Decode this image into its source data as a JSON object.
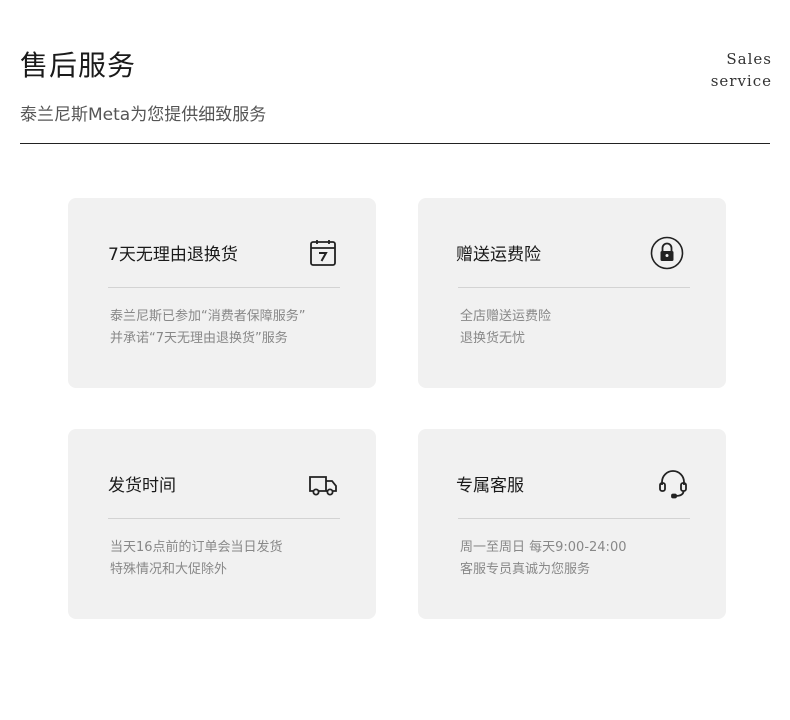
{
  "header": {
    "title": "售后服务",
    "subtitle": "泰兰尼斯Meta为您提供细致服务",
    "en_line1": "Sales",
    "en_line2": "service"
  },
  "cards": [
    {
      "title": "7天无理由退换货",
      "icon": "calendar-7-icon",
      "line1": "泰兰尼斯已参加“消费者保障服务”",
      "line2": "并承诺“7天无理由退换货”服务"
    },
    {
      "title": "赠送运费险",
      "icon": "lock-icon",
      "line1": "全店赠送运费险",
      "line2": "退换货无忧"
    },
    {
      "title": "发货时间",
      "icon": "truck-icon",
      "line1": "当天16点前的订单会当日发货",
      "line2": "特殊情况和大促除外"
    },
    {
      "title": "专属客服",
      "icon": "headset-icon",
      "line1": "周一至周日  每天9:00-24:00",
      "line2": "客服专员真诚为您服务"
    }
  ]
}
